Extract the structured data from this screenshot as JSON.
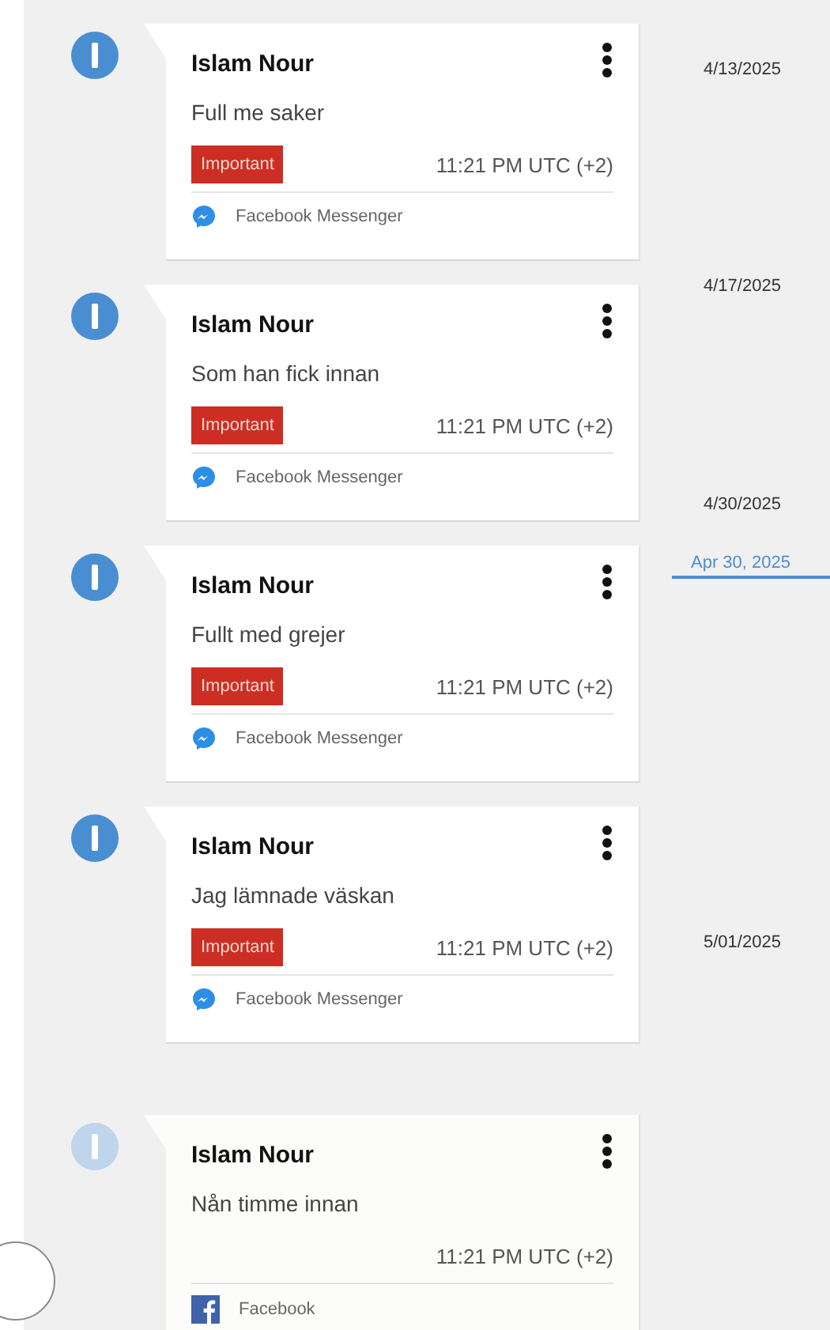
{
  "messages": [
    {
      "author": "Islam Nour",
      "text": "Full me saker",
      "badge": "Important",
      "time": "11:21 PM UTC (+2)",
      "source": {
        "kind": "messenger",
        "label": "Facebook Messenger"
      },
      "faded": false
    },
    {
      "author": "Islam Nour",
      "text": "Som han fick innan",
      "badge": "Important",
      "time": "11:21 PM UTC (+2)",
      "source": {
        "kind": "messenger",
        "label": "Facebook Messenger"
      },
      "faded": false
    },
    {
      "author": "Islam Nour",
      "text": "Fullt med grejer",
      "badge": "Important",
      "time": "11:21 PM UTC (+2)",
      "source": {
        "kind": "messenger",
        "label": "Facebook Messenger"
      },
      "faded": false
    },
    {
      "author": "Islam Nour",
      "text": "Jag lämnade väskan",
      "badge": "Important",
      "time": "11:21 PM UTC (+2)",
      "source": {
        "kind": "messenger",
        "label": "Facebook Messenger"
      },
      "faded": false
    },
    {
      "author": "Islam Nour",
      "text": "Nån timme innan",
      "time": "11:21 PM UTC (+2)",
      "source": {
        "kind": "facebook",
        "label": "Facebook"
      },
      "faded": true
    }
  ],
  "timeline": [
    {
      "kind": "date",
      "label": "4/13/2025"
    },
    {
      "kind": "date",
      "label": "4/17/2025"
    },
    {
      "kind": "date",
      "label": "4/30/2025"
    },
    {
      "kind": "marker",
      "label": "Apr 30, 2025"
    },
    {
      "kind": "date",
      "label": "5/01/2025"
    }
  ]
}
